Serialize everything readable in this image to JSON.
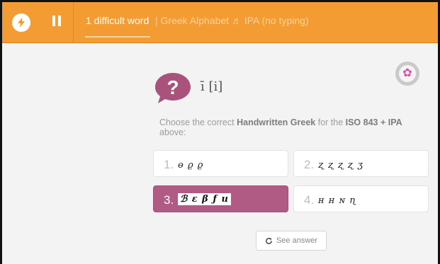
{
  "header": {
    "title": "1 difficult word",
    "subtitle": "| Greek Alphabet ♬ IPA (no typing)",
    "left_icon": "lightning-icon",
    "pause_icon": "pause-icon"
  },
  "question": {
    "prompt": "ī [i]",
    "instruction_prefix": "Choose the correct ",
    "instruction_answer_type": "Handwritten Greek",
    "instruction_middle": " for the ",
    "instruction_source": "ISO 843 + IPA",
    "instruction_suffix": " above:",
    "icon": "question-mark-icon",
    "badge_icon": "flower-icon"
  },
  "options": [
    {
      "number": "1.",
      "glyphs": "ɵ ϱ ϱ"
    },
    {
      "number": "2.",
      "glyphs": "ʐ ʐ ʐ ʐ ʒ"
    },
    {
      "number": "3.",
      "glyphs": "ℬ ε β ƒ u",
      "selected": true
    },
    {
      "number": "4.",
      "glyphs": "ʜ ʜ ɴ ɳ"
    }
  ],
  "see_answer": {
    "label": "See answer",
    "icon": "refresh-icon"
  },
  "colors": {
    "accent": "#f39c34",
    "selected": "#b05b84",
    "question_icon": "#a8527c"
  }
}
